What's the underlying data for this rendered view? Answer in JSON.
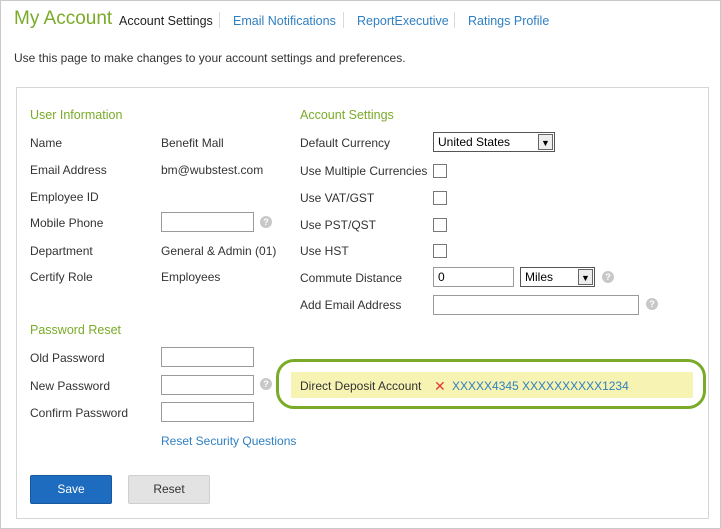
{
  "header": {
    "title": "My Account",
    "tabs": [
      {
        "label": "Account Settings",
        "active": true
      },
      {
        "label": "Email Notifications",
        "active": false
      },
      {
        "label": "ReportExecutive",
        "active": false
      },
      {
        "label": "Ratings Profile",
        "active": false
      }
    ],
    "intro": "Use this page to make changes to your account settings and preferences."
  },
  "user_info": {
    "heading": "User Information",
    "rows": [
      {
        "label": "Name",
        "value": "Benefit Mall"
      },
      {
        "label": "Email Address",
        "value": "bm@wubstest.com"
      },
      {
        "label": "Employee ID",
        "value": ""
      },
      {
        "label": "Mobile Phone",
        "value": ""
      },
      {
        "label": "Department",
        "value": "General & Admin (01)"
      },
      {
        "label": "Certify Role",
        "value": "Employees"
      }
    ]
  },
  "password_reset": {
    "heading": "Password Reset",
    "old_label": "Old Password",
    "new_label": "New Password",
    "confirm_label": "Confirm Password",
    "reset_link": "Reset Security Questions"
  },
  "account_settings": {
    "heading": "Account Settings",
    "default_currency_label": "Default Currency",
    "default_currency_value": "United States Dollars",
    "multi_currency_label": "Use Multiple Currencies",
    "vat_label": "Use VAT/GST",
    "pst_label": "Use PST/QST",
    "hst_label": "Use HST",
    "commute_label": "Commute Distance",
    "commute_value": "0",
    "commute_unit": "Miles",
    "add_email_label": "Add Email Address",
    "add_email_value": ""
  },
  "direct_deposit": {
    "label": "Direct Deposit Account",
    "value": "XXXXX4345 XXXXXXXXXX1234"
  },
  "buttons": {
    "save": "Save",
    "reset": "Reset"
  },
  "colors": {
    "accent_green": "#7aab28",
    "link_blue": "#2f7fc1",
    "save_blue": "#1e6cbf",
    "highlight_yellow": "#f7f4b3",
    "remove_red": "#e03b3b"
  },
  "icons": {
    "help": "help-icon",
    "remove": "close-icon",
    "dropdown": "chevron-down-icon"
  }
}
